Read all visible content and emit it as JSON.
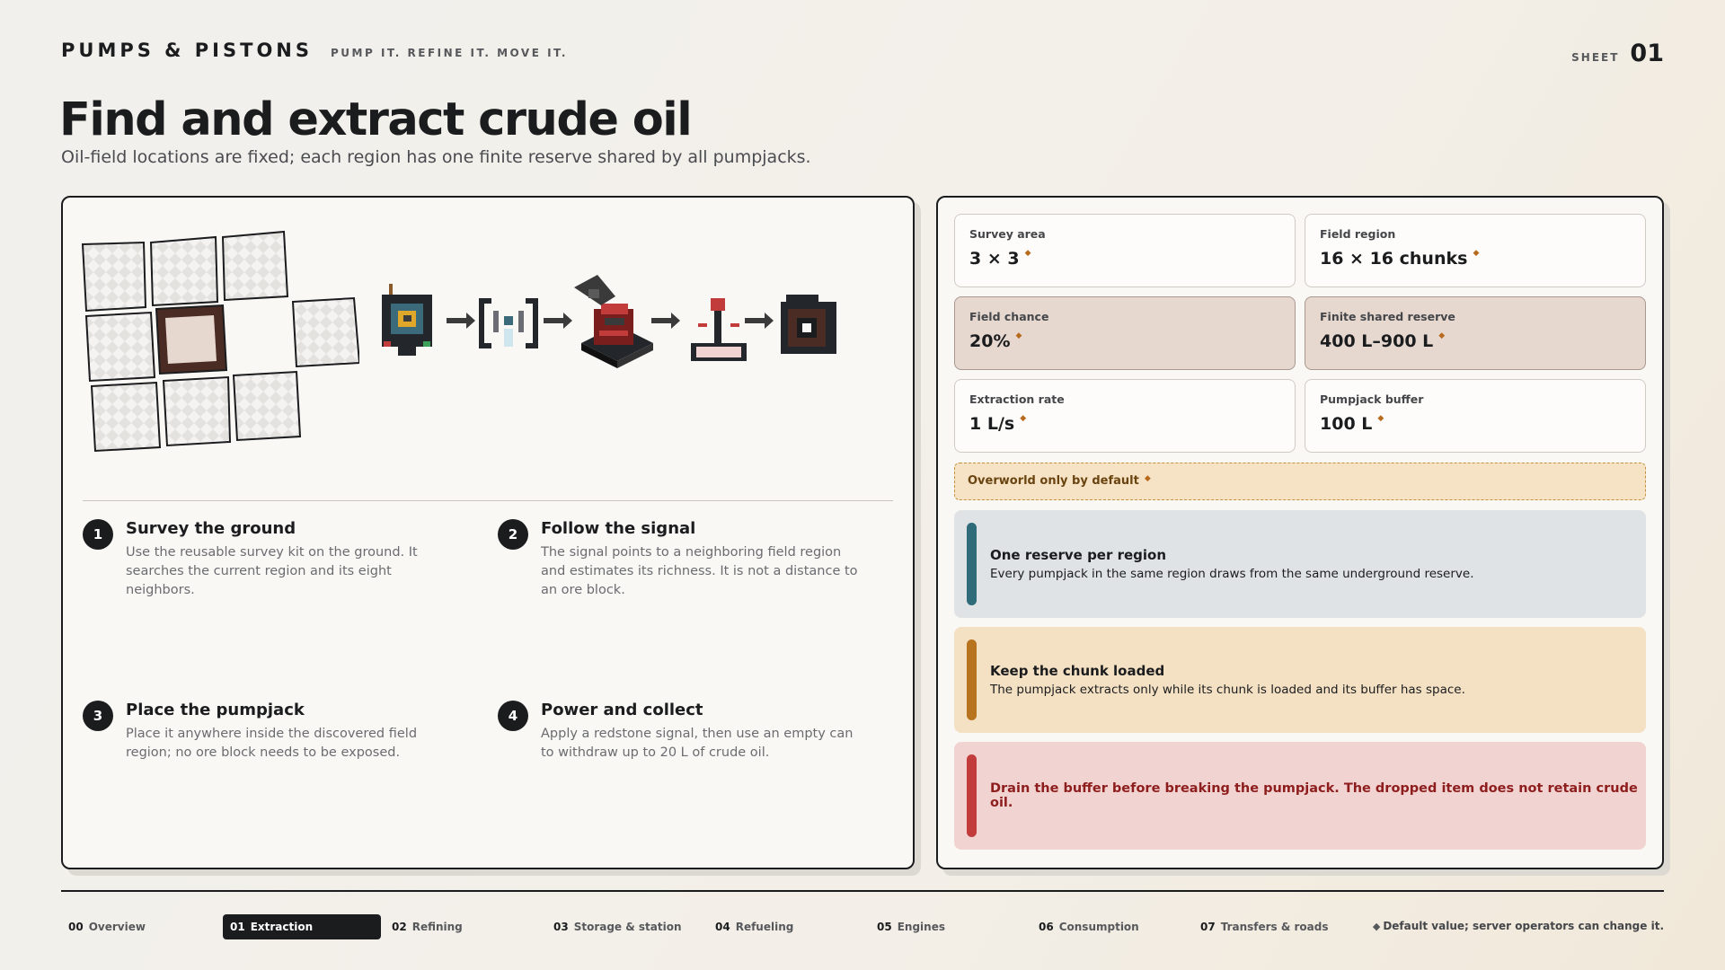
{
  "brand": {
    "name": "PUMPS & PISTONS",
    "tagline": "PUMP IT. REFINE IT. MOVE IT."
  },
  "sheet": {
    "label": "SHEET",
    "number": "01"
  },
  "page": {
    "title": "Find and extract crude oil",
    "subtitle": "Oil-field locations are fixed; each region has one finite reserve shared by all pumpjacks."
  },
  "steps": [
    {
      "num": "1",
      "title": "Survey the ground",
      "body": "Use the reusable survey kit on the ground. It searches the current region and its eight neighbors."
    },
    {
      "num": "2",
      "title": "Follow the signal",
      "body": "The signal points to a neighboring field region and estimates its richness. It is not a distance to an ore block."
    },
    {
      "num": "3",
      "title": "Place the pumpjack",
      "body": "Place it anywhere inside the discovered field region; no ore block needs to be exposed."
    },
    {
      "num": "4",
      "title": "Power and collect",
      "body": "Apply a redstone signal, then use an empty can to withdraw up to 20 L of crude oil."
    }
  ],
  "stats": [
    {
      "label": "Survey area",
      "value": "3 × 3",
      "highlight": false
    },
    {
      "label": "Field region",
      "value": "16 × 16 chunks",
      "highlight": false
    },
    {
      "label": "Field chance",
      "value": "20%",
      "highlight": true
    },
    {
      "label": "Finite shared reserve",
      "value": "400 L–900 L",
      "highlight": true
    },
    {
      "label": "Extraction rate",
      "value": "1 L/s",
      "highlight": false
    },
    {
      "label": "Pumpjack buffer",
      "value": "100 L",
      "highlight": false
    }
  ],
  "default_marker": "◆",
  "overworld_note": "Overworld only by default",
  "notes": [
    {
      "title": "One reserve per region",
      "body": "Every pumpjack in the same region draws from the same underground reserve."
    },
    {
      "title": "Keep the chunk loaded",
      "body": "The pumpjack extracts only while its chunk is loaded and its buffer has space."
    },
    {
      "title": "",
      "body": "Drain the buffer before breaking the pumpjack. The dropped item does not retain crude oil."
    }
  ],
  "nav": [
    {
      "num": "00",
      "label": "Overview",
      "active": false
    },
    {
      "num": "01",
      "label": "Extraction",
      "active": true
    },
    {
      "num": "02",
      "label": "Refining",
      "active": false
    },
    {
      "num": "03",
      "label": "Storage & station",
      "active": false
    },
    {
      "num": "04",
      "label": "Refueling",
      "active": false
    },
    {
      "num": "05",
      "label": "Engines",
      "active": false
    },
    {
      "num": "06",
      "label": "Consumption",
      "active": false
    },
    {
      "num": "07",
      "label": "Transfers & roads",
      "active": false
    }
  ],
  "legend": {
    "marker": "◆",
    "text": "Default value; server operators can change it."
  },
  "colors": {
    "ink": "#1b1c1e",
    "accent_blue": "#2f6b78",
    "accent_amber": "#b8731f",
    "accent_red": "#c23c3c"
  }
}
